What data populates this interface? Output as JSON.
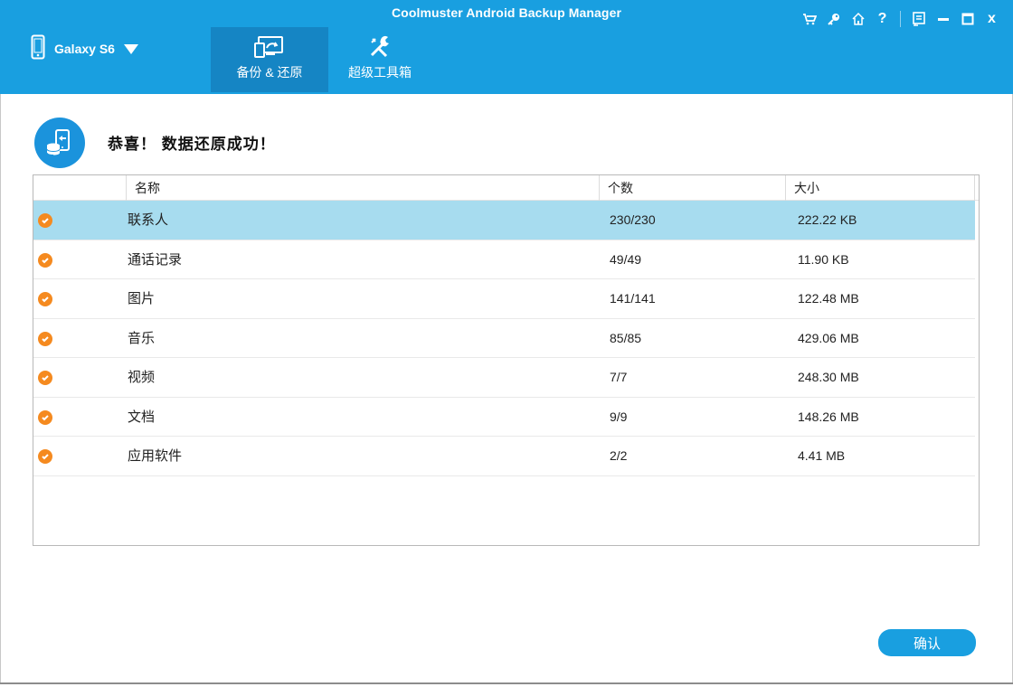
{
  "window": {
    "title": "Coolmuster Android Backup Manager"
  },
  "colors": {
    "header": "#199fe0",
    "active_tab": "#1585c4",
    "selected_row": "#a7dcef",
    "check": "#f58a1f"
  },
  "toolbar_icons": [
    "cart-icon",
    "key-icon",
    "home-icon",
    "help-icon",
    "feedback-icon",
    "minimize-icon",
    "maximize-icon",
    "close-icon"
  ],
  "toolbar": {
    "help_glyph": "?",
    "close_glyph": "x"
  },
  "device": {
    "name": "Galaxy S6",
    "icon": "phone-icon"
  },
  "tabs": [
    {
      "label": "备份 & 还原",
      "icon": "backup-restore-icon",
      "active": true
    },
    {
      "label": "超级工具箱",
      "icon": "toolbox-icon",
      "active": false
    }
  ],
  "main": {
    "message": "恭喜！ 数据还原成功！",
    "icon": "restore-success-icon"
  },
  "table": {
    "columns": [
      "名称",
      "个数",
      "大小"
    ],
    "rows": [
      {
        "name": "联系人",
        "count": "230/230",
        "size": "222.22 KB",
        "selected": true
      },
      {
        "name": "通话记录",
        "count": "49/49",
        "size": "11.90 KB",
        "selected": false
      },
      {
        "name": "图片",
        "count": "141/141",
        "size": "122.48 MB",
        "selected": false
      },
      {
        "name": "音乐",
        "count": "85/85",
        "size": "429.06 MB",
        "selected": false
      },
      {
        "name": "视频",
        "count": "7/7",
        "size": "248.30 MB",
        "selected": false
      },
      {
        "name": "文档",
        "count": "9/9",
        "size": "148.26 MB",
        "selected": false
      },
      {
        "name": "应用软件",
        "count": "2/2",
        "size": "4.41 MB",
        "selected": false
      }
    ]
  },
  "buttons": {
    "confirm": "确认"
  }
}
